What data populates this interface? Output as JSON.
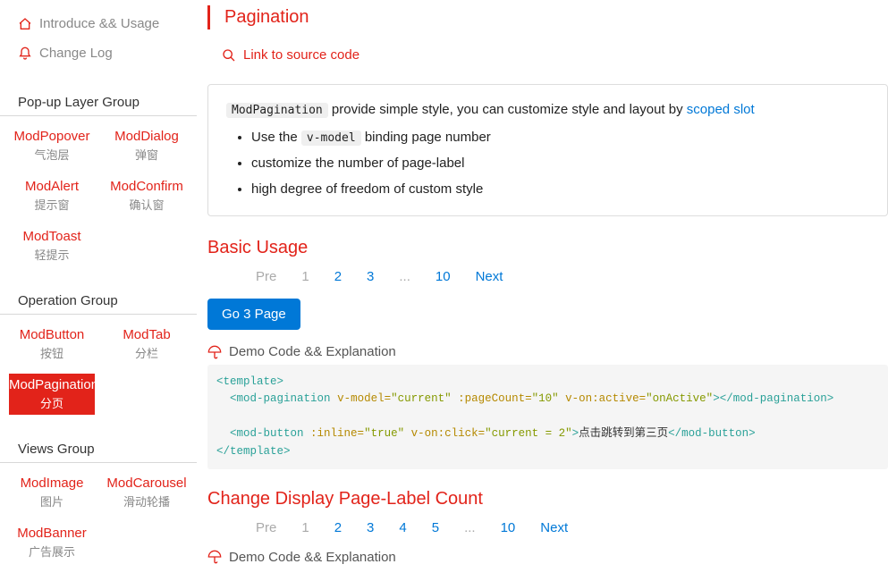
{
  "sidebar": {
    "top_links": [
      {
        "label": "Introduce && Usage",
        "icon": "home"
      },
      {
        "label": "Change Log",
        "icon": "bell"
      }
    ],
    "groups": [
      {
        "title": "Pop-up Layer Group",
        "items": [
          {
            "en": "ModPopover",
            "cn": "气泡层",
            "active": false
          },
          {
            "en": "ModDialog",
            "cn": "弹窗",
            "active": false
          },
          {
            "en": "ModAlert",
            "cn": "提示窗",
            "active": false
          },
          {
            "en": "ModConfirm",
            "cn": "确认窗",
            "active": false
          },
          {
            "en": "ModToast",
            "cn": "轻提示",
            "active": false
          }
        ]
      },
      {
        "title": "Operation Group",
        "items": [
          {
            "en": "ModButton",
            "cn": "按钮",
            "active": false
          },
          {
            "en": "ModTab",
            "cn": "分栏",
            "active": false
          },
          {
            "en": "ModPagination",
            "cn": "分页",
            "active": true
          }
        ]
      },
      {
        "title": "Views Group",
        "items": [
          {
            "en": "ModImage",
            "cn": "图片",
            "active": false
          },
          {
            "en": "ModCarousel",
            "cn": "滑动轮播",
            "active": false
          },
          {
            "en": "ModBanner",
            "cn": "广告展示",
            "active": false
          }
        ]
      }
    ]
  },
  "page": {
    "title": "Pagination",
    "source_link": "Link to source code",
    "info": {
      "code": "ModPagination",
      "desc1": " provide simple style, you can customize style and layout by ",
      "scoped": "scoped slot",
      "bullets": [
        {
          "pre": "Use the ",
          "code": "v-model",
          "post": " binding page number"
        },
        {
          "pre": "customize the number of page-label",
          "code": "",
          "post": ""
        },
        {
          "pre": "high degree of freedom of custom style",
          "code": "",
          "post": ""
        }
      ]
    },
    "section1": {
      "title": "Basic Usage",
      "pagination": {
        "pre": "Pre",
        "pages": [
          "1",
          "2",
          "3",
          "...",
          "10"
        ],
        "current": "1",
        "next": "Next"
      },
      "button": "Go 3 Page",
      "demo_title": "Demo Code && Explanation"
    },
    "section2": {
      "title": "Change Display Page-Label Count",
      "pagination": {
        "pre": "Pre",
        "pages": [
          "1",
          "2",
          "3",
          "4",
          "5",
          "...",
          "10"
        ],
        "current": "1",
        "next": "Next"
      },
      "demo_title": "Demo Code && Explanation"
    },
    "code1": {
      "line1_open": "<template>",
      "line2": "  <mod-pagination v-model=\"current\" :pageCount=\"10\" v-on:active=\"onActive\"></mod-pagination>",
      "line3": "",
      "line4": "  <mod-button :inline=\"true\" v-on:click=\"current = 2\">点击跳转到第三页</mod-button>",
      "line1_close": "</template>"
    }
  }
}
